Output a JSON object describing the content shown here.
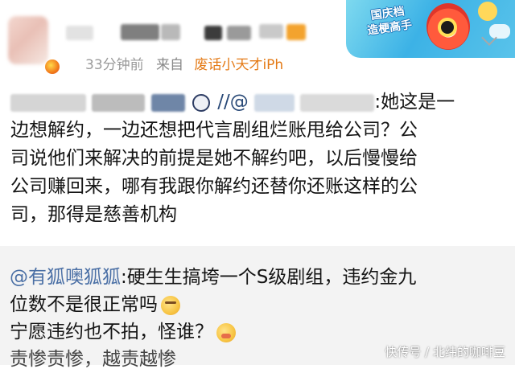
{
  "header": {
    "time": "33分钟前",
    "from_label": "来自",
    "device": "废话小天才iPh"
  },
  "promo": {
    "text_line1": "国庆档",
    "text_line2": "造梗高手"
  },
  "post": {
    "line1_prefix": "",
    "line1_mid": "//@",
    "line1_suffix": ":她这是一",
    "line2": "边想解约，一边还想把代言剧组烂账甩给公司？公",
    "line3": "司说他们来解决的前提是她不解约吧，以后慢慢给",
    "line4": "公司赚回来，哪有我跟你解约还替你还账这样的公",
    "line5": "司，那得是慈善机构"
  },
  "comment": {
    "mention": "@有狐噢狐狐",
    "line1": ":硬生生搞垮一个S级剧组，违约金九",
    "line2": "位数不是很正常吗",
    "line3": "宁愿违约也不拍，怪谁？",
    "line4": "责惨责惨，越责越惨"
  },
  "watermark": "快传号 / 北纬的咖啡豆",
  "colors": {
    "device": "#e47a16",
    "mention": "#4a6fa5",
    "comment_bg": "#f3f3f3"
  }
}
